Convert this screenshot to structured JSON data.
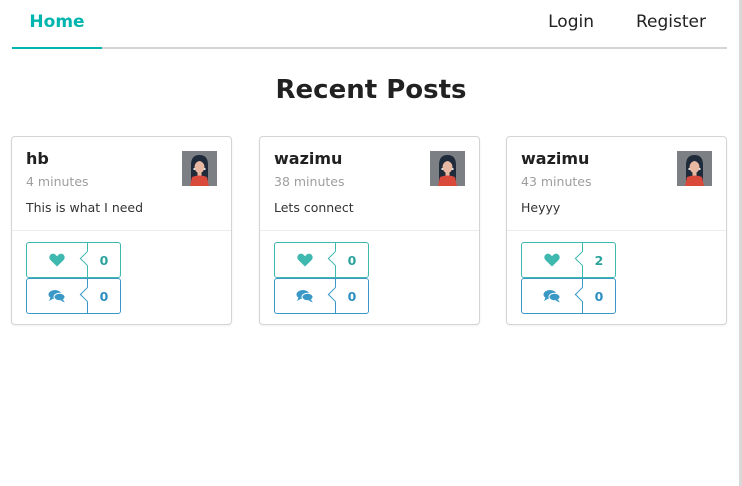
{
  "nav": {
    "home_label": "Home",
    "login_label": "Login",
    "register_label": "Register"
  },
  "page_title": "Recent Posts",
  "colors": {
    "accent": "#00b5ad",
    "like": "#3fb8b0",
    "comment": "#3a98c7"
  },
  "posts": [
    {
      "author": "hb",
      "time": "4 minutes",
      "text": "This is what I need",
      "likes": "0",
      "comments": "0"
    },
    {
      "author": "wazimu",
      "time": "38 minutes",
      "text": "Lets connect",
      "likes": "0",
      "comments": "0"
    },
    {
      "author": "wazimu",
      "time": "43 minutes",
      "text": "Heyyy",
      "likes": "2",
      "comments": "0"
    }
  ],
  "icons": {
    "like": "heart-icon",
    "comment": "comments-icon"
  }
}
